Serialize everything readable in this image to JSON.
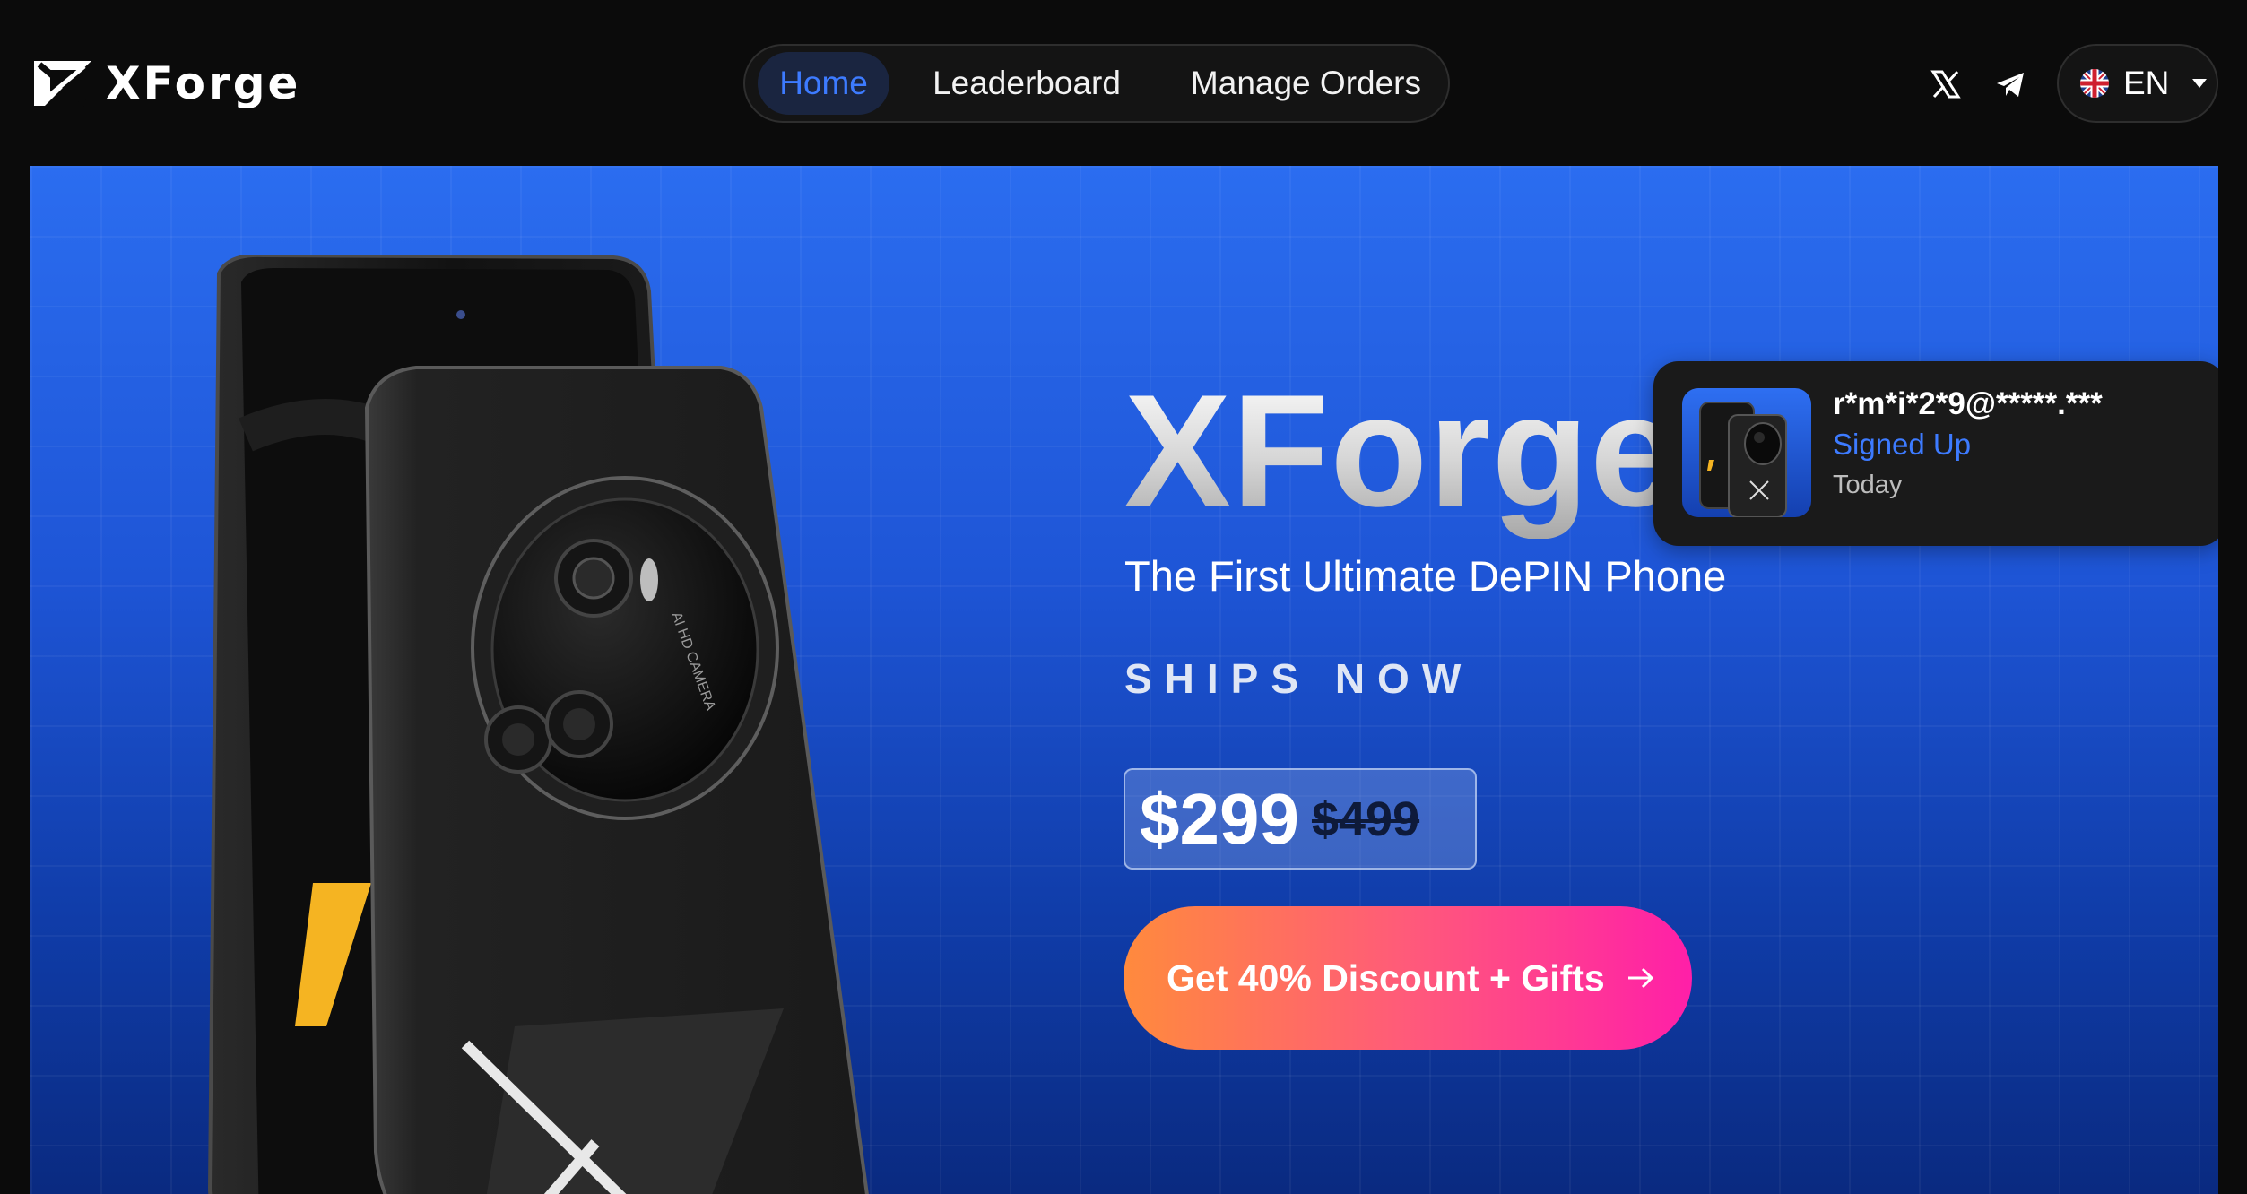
{
  "brand": {
    "name": "XForge"
  },
  "nav": {
    "items": [
      {
        "label": "Home",
        "active": true
      },
      {
        "label": "Leaderboard",
        "active": false
      },
      {
        "label": "Manage Orders",
        "active": false
      }
    ]
  },
  "social": {
    "icons": [
      "x-icon",
      "telegram-icon"
    ]
  },
  "language": {
    "code": "EN",
    "flag": "uk-flag-icon"
  },
  "hero": {
    "title": "XForge",
    "subtitle": "The First Ultimate DePIN Phone",
    "status": "SHIPS NOW",
    "price_current": "$299",
    "price_original": "$499",
    "cta_label": "Get 40% Discount + Gifts",
    "phone_camera_text": "AI HD CAMERA"
  },
  "notification": {
    "user": "r*m*i*2*9@*****.***",
    "status": "Signed Up",
    "time": "Today"
  },
  "colors": {
    "accent_blue": "#3d7bff",
    "hero_blue_top": "#2b6df0",
    "hero_blue_bottom": "#0a2a80",
    "cta_start": "#ff8a3d",
    "cta_end": "#ff1fa8",
    "logo_accent": "#f5b422"
  }
}
